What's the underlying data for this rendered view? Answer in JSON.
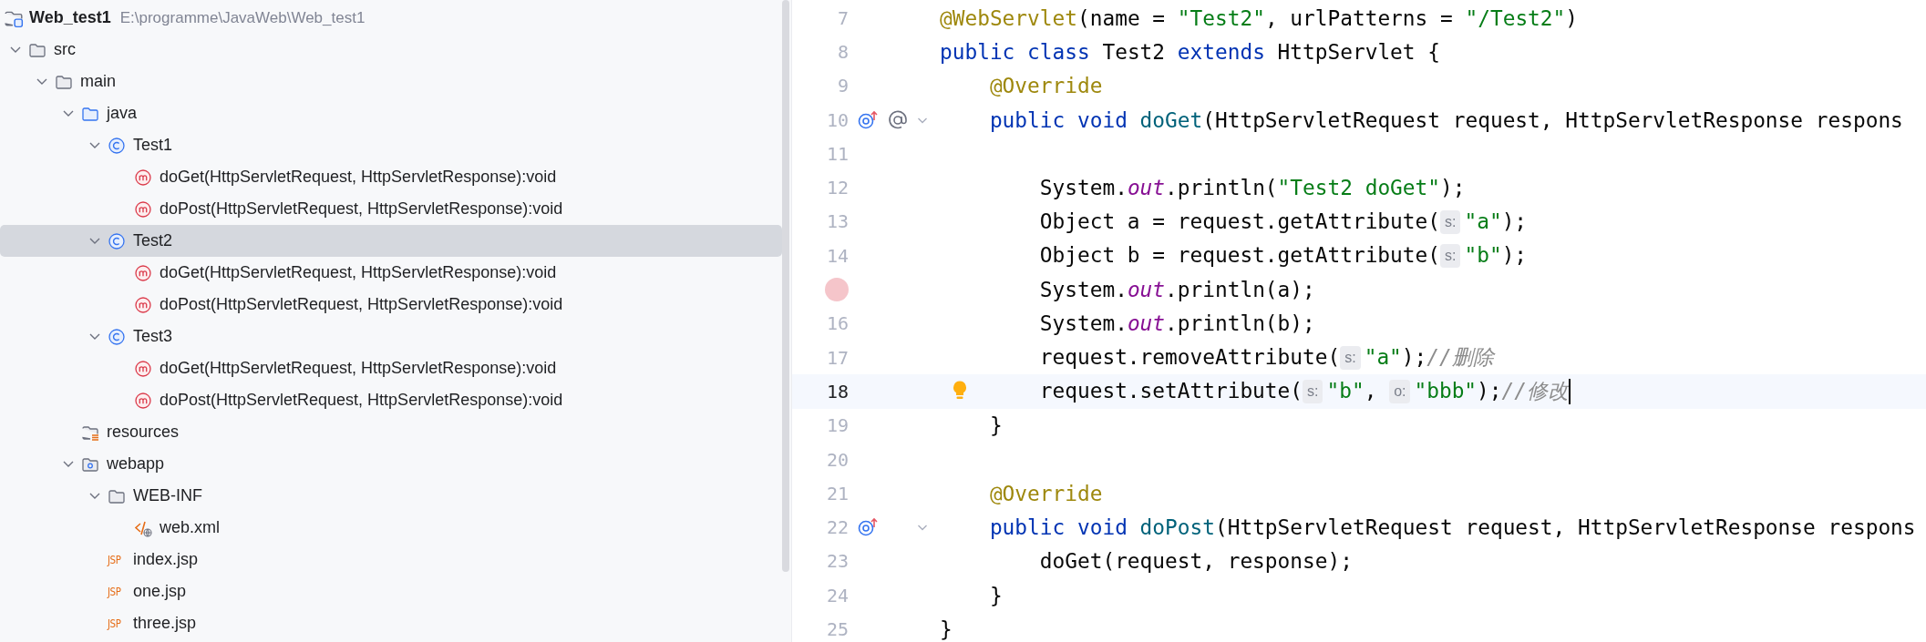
{
  "project": {
    "name": "Web_test1",
    "path": "E:\\programme\\JavaWeb\\Web_test1"
  },
  "tree": [
    {
      "label": "src",
      "kind": "folder",
      "expanded": true,
      "selected": false,
      "children": [
        {
          "label": "main",
          "kind": "folder",
          "expanded": true,
          "selected": false,
          "children": [
            {
              "label": "java",
              "kind": "source-folder",
              "expanded": true,
              "selected": false,
              "children": [
                {
                  "label": "Test1",
                  "kind": "class",
                  "expanded": true,
                  "selected": false,
                  "children": [
                    {
                      "label": "doGet(HttpServletRequest, HttpServletResponse):void",
                      "kind": "method",
                      "selected": false
                    },
                    {
                      "label": "doPost(HttpServletRequest, HttpServletResponse):void",
                      "kind": "method",
                      "selected": false
                    }
                  ]
                },
                {
                  "label": "Test2",
                  "kind": "class",
                  "expanded": true,
                  "selected": true,
                  "children": [
                    {
                      "label": "doGet(HttpServletRequest, HttpServletResponse):void",
                      "kind": "method",
                      "selected": false
                    },
                    {
                      "label": "doPost(HttpServletRequest, HttpServletResponse):void",
                      "kind": "method",
                      "selected": false
                    }
                  ]
                },
                {
                  "label": "Test3",
                  "kind": "class",
                  "expanded": true,
                  "selected": false,
                  "children": [
                    {
                      "label": "doGet(HttpServletRequest, HttpServletResponse):void",
                      "kind": "method",
                      "selected": false
                    },
                    {
                      "label": "doPost(HttpServletRequest, HttpServletResponse):void",
                      "kind": "method",
                      "selected": false
                    }
                  ]
                }
              ]
            },
            {
              "label": "resources",
              "kind": "resources-folder",
              "selected": false
            },
            {
              "label": "webapp",
              "kind": "web-folder",
              "expanded": true,
              "selected": false,
              "children": [
                {
                  "label": "WEB-INF",
                  "kind": "folder",
                  "expanded": true,
                  "selected": false,
                  "children": [
                    {
                      "label": "web.xml",
                      "kind": "xml-file",
                      "selected": false
                    }
                  ]
                },
                {
                  "label": "index.jsp",
                  "kind": "jsp-file",
                  "icon_text": "JSP",
                  "selected": false
                },
                {
                  "label": "one.jsp",
                  "kind": "jsp-file",
                  "icon_text": "JSP",
                  "selected": false
                },
                {
                  "label": "three.jsp",
                  "kind": "jsp-file",
                  "icon_text": "JSP",
                  "selected": false
                }
              ]
            }
          ]
        }
      ]
    }
  ],
  "editor": {
    "lines": [
      {
        "number": "7",
        "breakpoint": false,
        "current": false,
        "tokens": [
          {
            "kind": "annotation",
            "text": "@WebServlet"
          },
          {
            "kind": "plain",
            "text": "(name = "
          },
          {
            "kind": "string",
            "text": "\"Test2\""
          },
          {
            "kind": "plain",
            "text": ", urlPatterns = "
          },
          {
            "kind": "string",
            "text": "\"/Test2\""
          },
          {
            "kind": "plain",
            "text": ")"
          }
        ]
      },
      {
        "number": "8",
        "breakpoint": false,
        "current": false,
        "tokens": [
          {
            "kind": "keyword",
            "text": "public class"
          },
          {
            "kind": "plain",
            "text": " Test2 "
          },
          {
            "kind": "keyword",
            "text": "extends"
          },
          {
            "kind": "plain",
            "text": " HttpServlet {"
          }
        ]
      },
      {
        "number": "9",
        "breakpoint": false,
        "current": false,
        "tokens": [
          {
            "kind": "annotation",
            "text": "    @Override"
          }
        ]
      },
      {
        "number": "10",
        "breakpoint": false,
        "current": false,
        "markers": [
          {
            "kind": "override"
          },
          {
            "kind": "annotation"
          },
          {
            "kind": "fold"
          }
        ],
        "tokens": [
          {
            "kind": "keyword",
            "text": "    public void "
          },
          {
            "kind": "function",
            "text": "doGet"
          },
          {
            "kind": "plain",
            "text": "(HttpServletRequest request, HttpServletResponse respons"
          }
        ]
      },
      {
        "number": "11",
        "breakpoint": false,
        "current": false
      },
      {
        "number": "12",
        "breakpoint": false,
        "current": false,
        "tokens": [
          {
            "kind": "plain",
            "text": "        System."
          },
          {
            "kind": "static",
            "text": "out"
          },
          {
            "kind": "plain",
            "text": ".println("
          },
          {
            "kind": "string",
            "text": "\"Test2 doGet\""
          },
          {
            "kind": "plain",
            "text": ");"
          }
        ]
      },
      {
        "number": "13",
        "breakpoint": false,
        "current": false,
        "tokens": [
          {
            "kind": "plain",
            "text": "        Object a = request.getAttribute("
          },
          {
            "kind": "hint",
            "text": "s:"
          },
          {
            "kind": "string",
            "text": "\"a\""
          },
          {
            "kind": "plain",
            "text": ");"
          }
        ]
      },
      {
        "number": "14",
        "breakpoint": false,
        "current": false,
        "tokens": [
          {
            "kind": "plain",
            "text": "        Object b = request.getAttribute("
          },
          {
            "kind": "hint",
            "text": "s:"
          },
          {
            "kind": "string",
            "text": "\"b\""
          },
          {
            "kind": "plain",
            "text": ");"
          }
        ]
      },
      {
        "breakpoint": true,
        "current": false,
        "tokens": [
          {
            "kind": "plain",
            "text": "        System."
          },
          {
            "kind": "static",
            "text": "out"
          },
          {
            "kind": "plain",
            "text": ".println(a);"
          }
        ]
      },
      {
        "number": "16",
        "breakpoint": false,
        "current": false,
        "tokens": [
          {
            "kind": "plain",
            "text": "        System."
          },
          {
            "kind": "static",
            "text": "out"
          },
          {
            "kind": "plain",
            "text": ".println(b);"
          }
        ]
      },
      {
        "number": "17",
        "breakpoint": false,
        "current": false,
        "tokens": [
          {
            "kind": "plain",
            "text": "        request.removeAttribute("
          },
          {
            "kind": "hint",
            "text": "s:"
          },
          {
            "kind": "string",
            "text": "\"a\""
          },
          {
            "kind": "plain",
            "text": ");"
          },
          {
            "kind": "comment",
            "text": "//删除"
          }
        ]
      },
      {
        "number": "18",
        "breakpoint": false,
        "current": true,
        "markers": [
          {
            "kind": "bulb"
          }
        ],
        "tokens": [
          {
            "kind": "plain",
            "text": "        request.setAttribute("
          },
          {
            "kind": "hint",
            "text": "s:"
          },
          {
            "kind": "string",
            "text": "\"b\""
          },
          {
            "kind": "plain",
            "text": ", "
          },
          {
            "kind": "hint",
            "text": "o:"
          },
          {
            "kind": "string",
            "text": "\"bbb\""
          },
          {
            "kind": "plain",
            "text": ");"
          },
          {
            "kind": "comment",
            "text": "//修改"
          }
        ]
      },
      {
        "number": "19",
        "breakpoint": false,
        "current": false,
        "tokens": [
          {
            "kind": "plain",
            "text": "    }"
          }
        ]
      },
      {
        "number": "20",
        "breakpoint": false,
        "current": false
      },
      {
        "number": "21",
        "breakpoint": false,
        "current": false,
        "tokens": [
          {
            "kind": "annotation",
            "text": "    @Override"
          }
        ]
      },
      {
        "number": "22",
        "breakpoint": false,
        "current": false,
        "markers": [
          {
            "kind": "override"
          },
          {
            "kind": "fold"
          }
        ],
        "tokens": [
          {
            "kind": "keyword",
            "text": "    public void "
          },
          {
            "kind": "function",
            "text": "doPost"
          },
          {
            "kind": "plain",
            "text": "(HttpServletRequest request, HttpServletResponse respons"
          }
        ]
      },
      {
        "number": "23",
        "breakpoint": false,
        "current": false,
        "tokens": [
          {
            "kind": "plain",
            "text": "        doGet(request, response);"
          }
        ]
      },
      {
        "number": "24",
        "breakpoint": false,
        "current": false,
        "tokens": [
          {
            "kind": "plain",
            "text": "    }"
          }
        ]
      },
      {
        "number": "25",
        "breakpoint": false,
        "current": false,
        "tokens": [
          {
            "kind": "plain",
            "text": "}"
          }
        ]
      }
    ]
  }
}
